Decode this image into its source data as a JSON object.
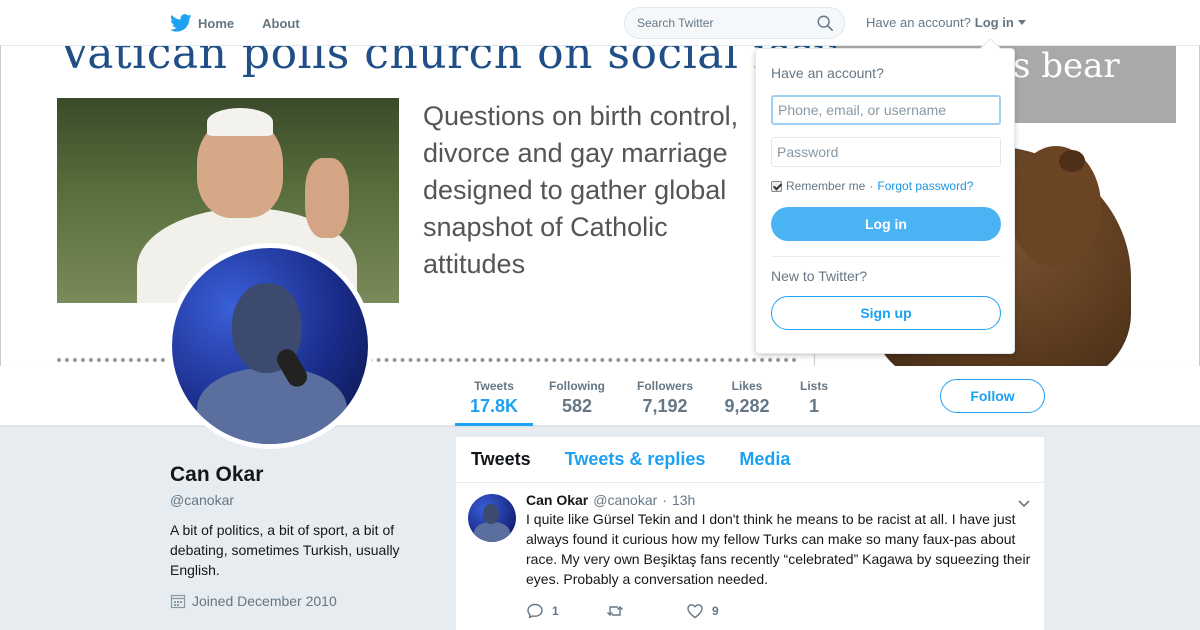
{
  "nav": {
    "home_label": "Home",
    "about_label": "About",
    "search_placeholder": "Search Twitter",
    "have_account": "Have an account?",
    "login_label": "Log in"
  },
  "banner": {
    "headline": "Vatican polls church on social issues",
    "subtext": "Questions on birth control, divorce and gay marriage designed to gather global snapshot of Catholic attitudes",
    "side_text": "s bear"
  },
  "login_dropdown": {
    "title": "Have an account?",
    "username_placeholder": "Phone, email, or username",
    "password_placeholder": "Password",
    "remember_label": "Remember me",
    "separator": "·",
    "forgot_label": "Forgot password?",
    "login_button": "Log in",
    "new_label": "New to Twitter?",
    "signup_button": "Sign up"
  },
  "stats": [
    {
      "label": "Tweets",
      "value": "17.8K"
    },
    {
      "label": "Following",
      "value": "582"
    },
    {
      "label": "Followers",
      "value": "7,192"
    },
    {
      "label": "Likes",
      "value": "9,282"
    },
    {
      "label": "Lists",
      "value": "1"
    }
  ],
  "follow_button": "Follow",
  "profile": {
    "name": "Can Okar",
    "handle": "@canokar",
    "bio": "A bit of politics, a bit of sport, a bit of debating, sometimes Turkish, usually English.",
    "joined": "Joined December 2010"
  },
  "timeline": {
    "tabs": [
      "Tweets",
      "Tweets & replies",
      "Media"
    ],
    "tweet": {
      "name": "Can Okar",
      "handle": "@canokar",
      "dot": "·",
      "time": "13h",
      "text": "I quite like Gürsel Tekin and I don't think he means to be racist at all. I have just always found it curious how my fellow Turks can make so many faux-pas about race. My very own Beşiktaş fans recently “celebrated” Kagawa by squeezing their eyes. Probably a conversation needed.",
      "replies": "1",
      "retweets": "",
      "likes": "9"
    }
  },
  "colors": {
    "accent": "#1da1f2",
    "button_fill": "#4ab3f4",
    "background": "#e6ecf0"
  },
  "icons": [
    "twitter-bird-icon",
    "search-icon",
    "caret-down-icon",
    "calendar-icon",
    "chevron-down-icon",
    "reply-icon",
    "retweet-icon",
    "heart-icon"
  ]
}
